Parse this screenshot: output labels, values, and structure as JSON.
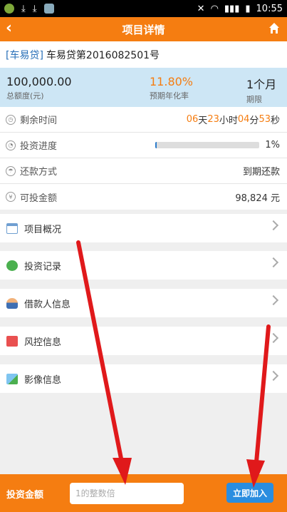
{
  "statusbar": {
    "time": "10:55",
    "battery": "▮",
    "signal": "▮▮▮"
  },
  "header": {
    "title": "项目详情",
    "back_icon": "‹",
    "home_icon": "home-icon"
  },
  "project": {
    "tag": "[车易贷]",
    "name": "车易贷第2016082501号"
  },
  "summary": {
    "total": {
      "value": "100,000.00",
      "label": "总额度(元)"
    },
    "rate": {
      "value": "11.80%",
      "label": "预期年化率"
    },
    "term": {
      "value": "1个月",
      "label": "期限"
    }
  },
  "info": {
    "remaining": {
      "label": "剩余时间",
      "days": "06",
      "days_unit": "天",
      "hours": "23",
      "hours_unit": "小时",
      "minutes": "04",
      "minutes_unit": "分",
      "seconds": "53",
      "seconds_unit": "秒"
    },
    "progress": {
      "label": "投资进度",
      "percent_text": "1%",
      "fraction": 0.01
    },
    "repay": {
      "label": "还款方式",
      "value": "到期还款"
    },
    "available": {
      "label": "可投金额",
      "value": "98,824 元"
    }
  },
  "menu": {
    "overview": "项目概况",
    "records": "投资记录",
    "borrower": "借款人信息",
    "risk": "风控信息",
    "images": "影像信息"
  },
  "bottom": {
    "label": "投资金额",
    "placeholder": "1的整数倍",
    "button": "立即加入"
  },
  "colors": {
    "primary": "#f57d11",
    "blue": "#2a8de0",
    "summary_bg": "#cde6f5",
    "arrow": "#e0191b"
  }
}
